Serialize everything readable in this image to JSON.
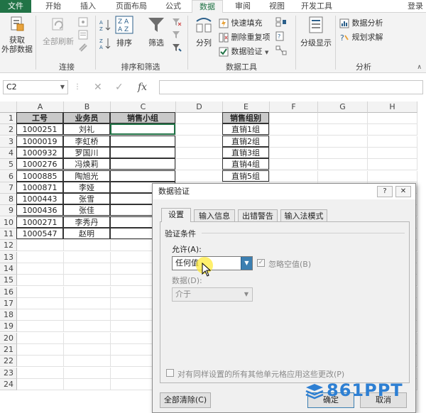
{
  "tabs": {
    "file": "文件",
    "home": "开始",
    "insert": "插入",
    "page_layout": "页面布局",
    "formulas": "公式",
    "data": "数据",
    "review": "审阅",
    "view": "视图",
    "developer": "开发工具",
    "login": "登录"
  },
  "ribbon": {
    "get_external": "获取\n外部数据",
    "refresh_all": "全部刷新",
    "connections_group": "连接",
    "sort": "排序",
    "filter": "筛选",
    "sort_filter_group": "排序和筛选",
    "split": "分列",
    "flash_fill": "快速填充",
    "remove_duplicates": "删除重复项",
    "data_validation": "数据验证",
    "data_tools_group": "数据工具",
    "outline": "分级显示",
    "data_analysis": "数据分析",
    "solver": "规划求解",
    "analysis_group": "分析"
  },
  "formula_bar": {
    "name_box": "C2",
    "cancel": "✕",
    "enter": "✓",
    "fx": "fx",
    "formula": ""
  },
  "columns": [
    "A",
    "B",
    "C",
    "D",
    "E",
    "F",
    "G",
    "H"
  ],
  "rows": [
    "1",
    "2",
    "3",
    "4",
    "5",
    "6",
    "7",
    "8",
    "9",
    "10",
    "11",
    "12",
    "13",
    "14",
    "15",
    "16",
    "17",
    "18",
    "19",
    "20",
    "21",
    "22",
    "23",
    "24"
  ],
  "table": {
    "headers": [
      "工号",
      "业务员",
      "销售小组"
    ],
    "data": [
      [
        "1000251",
        "刘礼",
        ""
      ],
      [
        "1000019",
        "李虹桥",
        ""
      ],
      [
        "1000932",
        "罗国川",
        ""
      ],
      [
        "1000276",
        "冯焕莉",
        ""
      ],
      [
        "1000885",
        "陶旭光",
        ""
      ],
      [
        "1000871",
        "李娅",
        ""
      ],
      [
        "1000443",
        "张雪",
        ""
      ],
      [
        "1000436",
        "张佳",
        ""
      ],
      [
        "1000271",
        "李秀丹",
        ""
      ],
      [
        "1000547",
        "赵明",
        ""
      ]
    ]
  },
  "groups_table": {
    "header": "销售组别",
    "items": [
      "直销1组",
      "直销2组",
      "直销3组",
      "直销4组",
      "直销5组"
    ]
  },
  "dialog": {
    "title": "数据验证",
    "help": "?",
    "close": "✕",
    "tabs": [
      "设置",
      "输入信息",
      "出错警告",
      "输入法模式"
    ],
    "section": "验证条件",
    "allow_label": "允许(A):",
    "allow_value": "任何值",
    "ignore_blank": "忽略空值(B)",
    "data_label": "数据(D):",
    "data_value": "介于",
    "apply_all": "对有同样设置的所有其他单元格应用这些更改(P)",
    "clear_all": "全部清除(C)",
    "ok": "确定",
    "cancel": "取消"
  },
  "watermark": "861PPT",
  "colors": {
    "excel_green": "#217346",
    "accent_blue": "#3c7fb1",
    "watermark": "#2d7fd3"
  }
}
